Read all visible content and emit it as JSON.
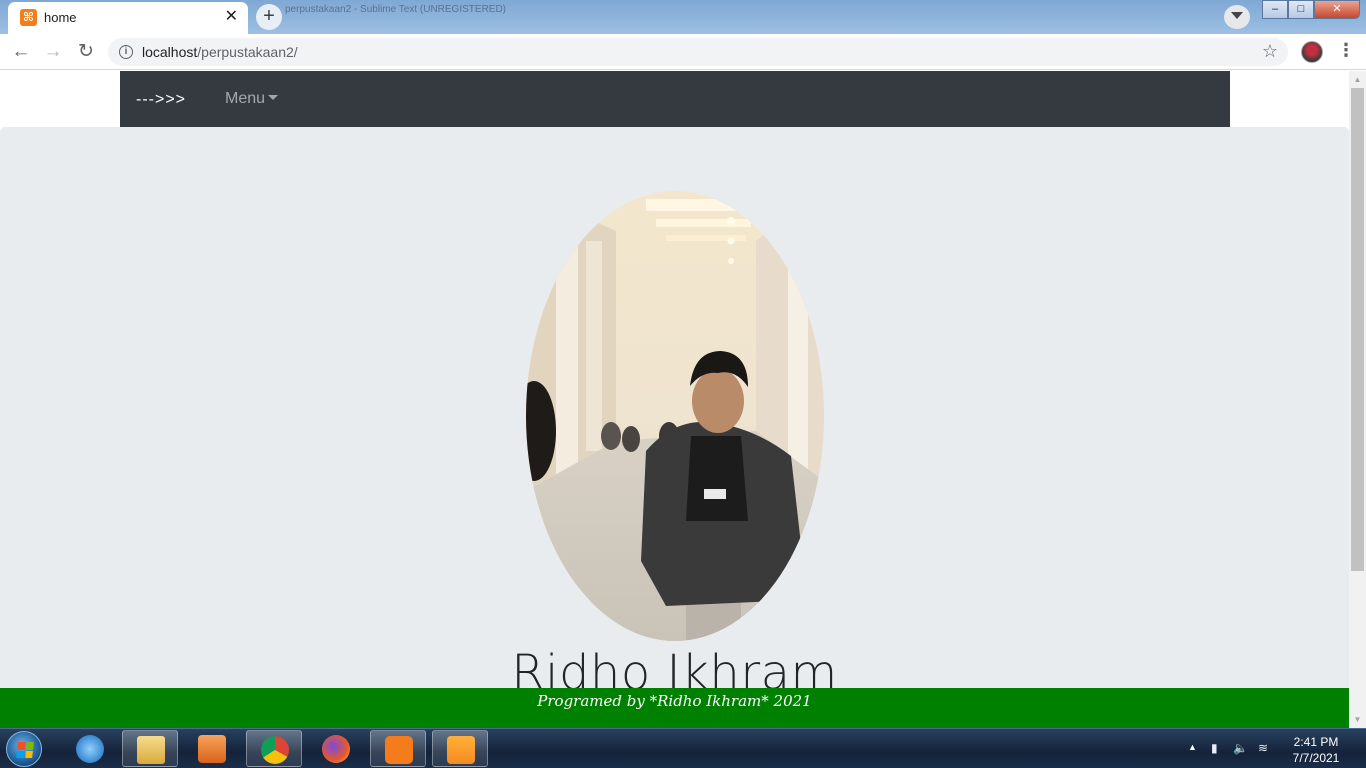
{
  "browser": {
    "tab_title": "home",
    "tab_favicon_glyph": "⌘",
    "new_tab_glyph": "+",
    "close_glyph": "✕",
    "background_window_title": "perpustakaan2 - Sublime Text (UNREGISTERED)",
    "url_host": "localhost",
    "url_path": "/perpustakaan2/",
    "window_min": "–",
    "window_max": "□",
    "window_close": "✕"
  },
  "navbar": {
    "brand": "--->>>",
    "menu_label": "Menu"
  },
  "hero": {
    "name": "Ridho Ikhram",
    "photo_icon": "profile-photo"
  },
  "footer": {
    "text": "Programed by *Ridho Ikhram* 2021",
    "color": "#008000"
  },
  "taskbar": {
    "time": "2:41 PM",
    "date": "7/7/2021"
  },
  "colors": {
    "navbar": "#343a40",
    "jumbotron": "#e9ecef",
    "footer": "#008000"
  }
}
